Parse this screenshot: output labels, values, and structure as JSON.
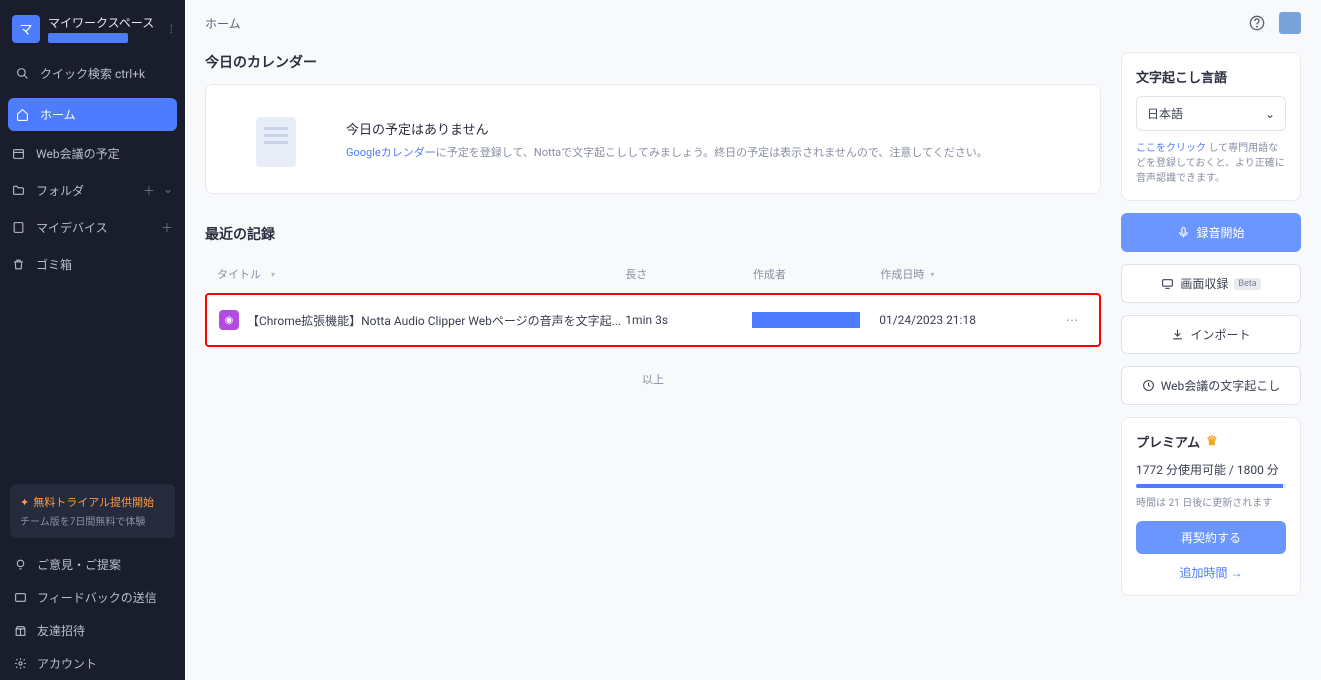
{
  "sidebar": {
    "workspace_name": "マイワークスペース",
    "workspace_initial": "マ",
    "quick_search": "クイック検索 ctrl+k",
    "items": [
      {
        "label": "ホーム"
      },
      {
        "label": "Web会議の予定"
      },
      {
        "label": "フォルダ"
      },
      {
        "label": "マイデバイス"
      },
      {
        "label": "ゴミ箱"
      }
    ],
    "trial": {
      "title": "無料トライアル提供開始",
      "sub": "チーム版を7日間無料で体験"
    },
    "footer": [
      {
        "label": "ご意見・ご提案"
      },
      {
        "label": "フィードバックの送信"
      },
      {
        "label": "友達招待"
      },
      {
        "label": "アカウント"
      }
    ]
  },
  "topbar": {
    "title": "ホーム"
  },
  "calendar": {
    "section_title": "今日のカレンダー",
    "empty_title": "今日の予定はありません",
    "link_text": "Googleカレンダー",
    "empty_sub": "に予定を登録して、Nottaで文字起こししてみましょう。終日の予定は表示されませんので、注意してください。"
  },
  "records": {
    "section_title": "最近の記録",
    "columns": {
      "title": "タイトル",
      "duration": "長さ",
      "author": "作成者",
      "date": "作成日時"
    },
    "rows": [
      {
        "title": "【Chrome拡張機能】Notta Audio Clipper Webページの音声を文字起...",
        "duration": "1min 3s",
        "date": "01/24/2023 21:18"
      }
    ],
    "end_text": "以上"
  },
  "right": {
    "lang_title": "文字起こし言語",
    "lang_value": "日本語",
    "lang_link": "ここをクリック",
    "lang_hint": "して専門用語などを登録しておくと、より正確に音声認識できます。",
    "actions": {
      "record": "録音開始",
      "screen": "画面収録",
      "screen_badge": "Beta",
      "import": "インポート",
      "meeting": "Web会議の文字起こし"
    },
    "premium": {
      "title": "プレミアム",
      "usage": "1772 分使用可能 / 1800 分",
      "note": "時間は 21 日後に更新されます",
      "renew": "再契約する",
      "add_time": "追加時間 →"
    }
  }
}
